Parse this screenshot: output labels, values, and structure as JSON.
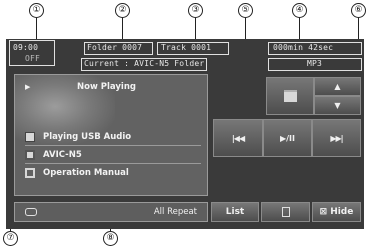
{
  "callouts": [
    "①",
    "②",
    "③",
    "④",
    "⑤",
    "⑥",
    "⑦",
    "⑧"
  ],
  "header": {
    "clock": "09:00",
    "clock_mode": "OFF",
    "folder": "Folder 0007",
    "track": "Track 0001",
    "time": "000min 42sec",
    "current_folder": "Current : AVIC-N5 Folder",
    "format": "MP3"
  },
  "panel": {
    "now_playing": "Now Playing",
    "items": [
      {
        "label": "Playing USB Audio",
        "icon": "usb-audio-icon"
      },
      {
        "label": "AVIC-N5",
        "icon": "folder-list-icon"
      },
      {
        "label": "Operation Manual",
        "icon": "disc-icon"
      }
    ]
  },
  "controls": {
    "prev": "|◀◀",
    "play_pause": "▶/II",
    "next": "▶▶|",
    "up": "▲",
    "down": "▼"
  },
  "bottom": {
    "repeat_label": "All Repeat",
    "list_label": "List",
    "hide_label": "Hide"
  }
}
